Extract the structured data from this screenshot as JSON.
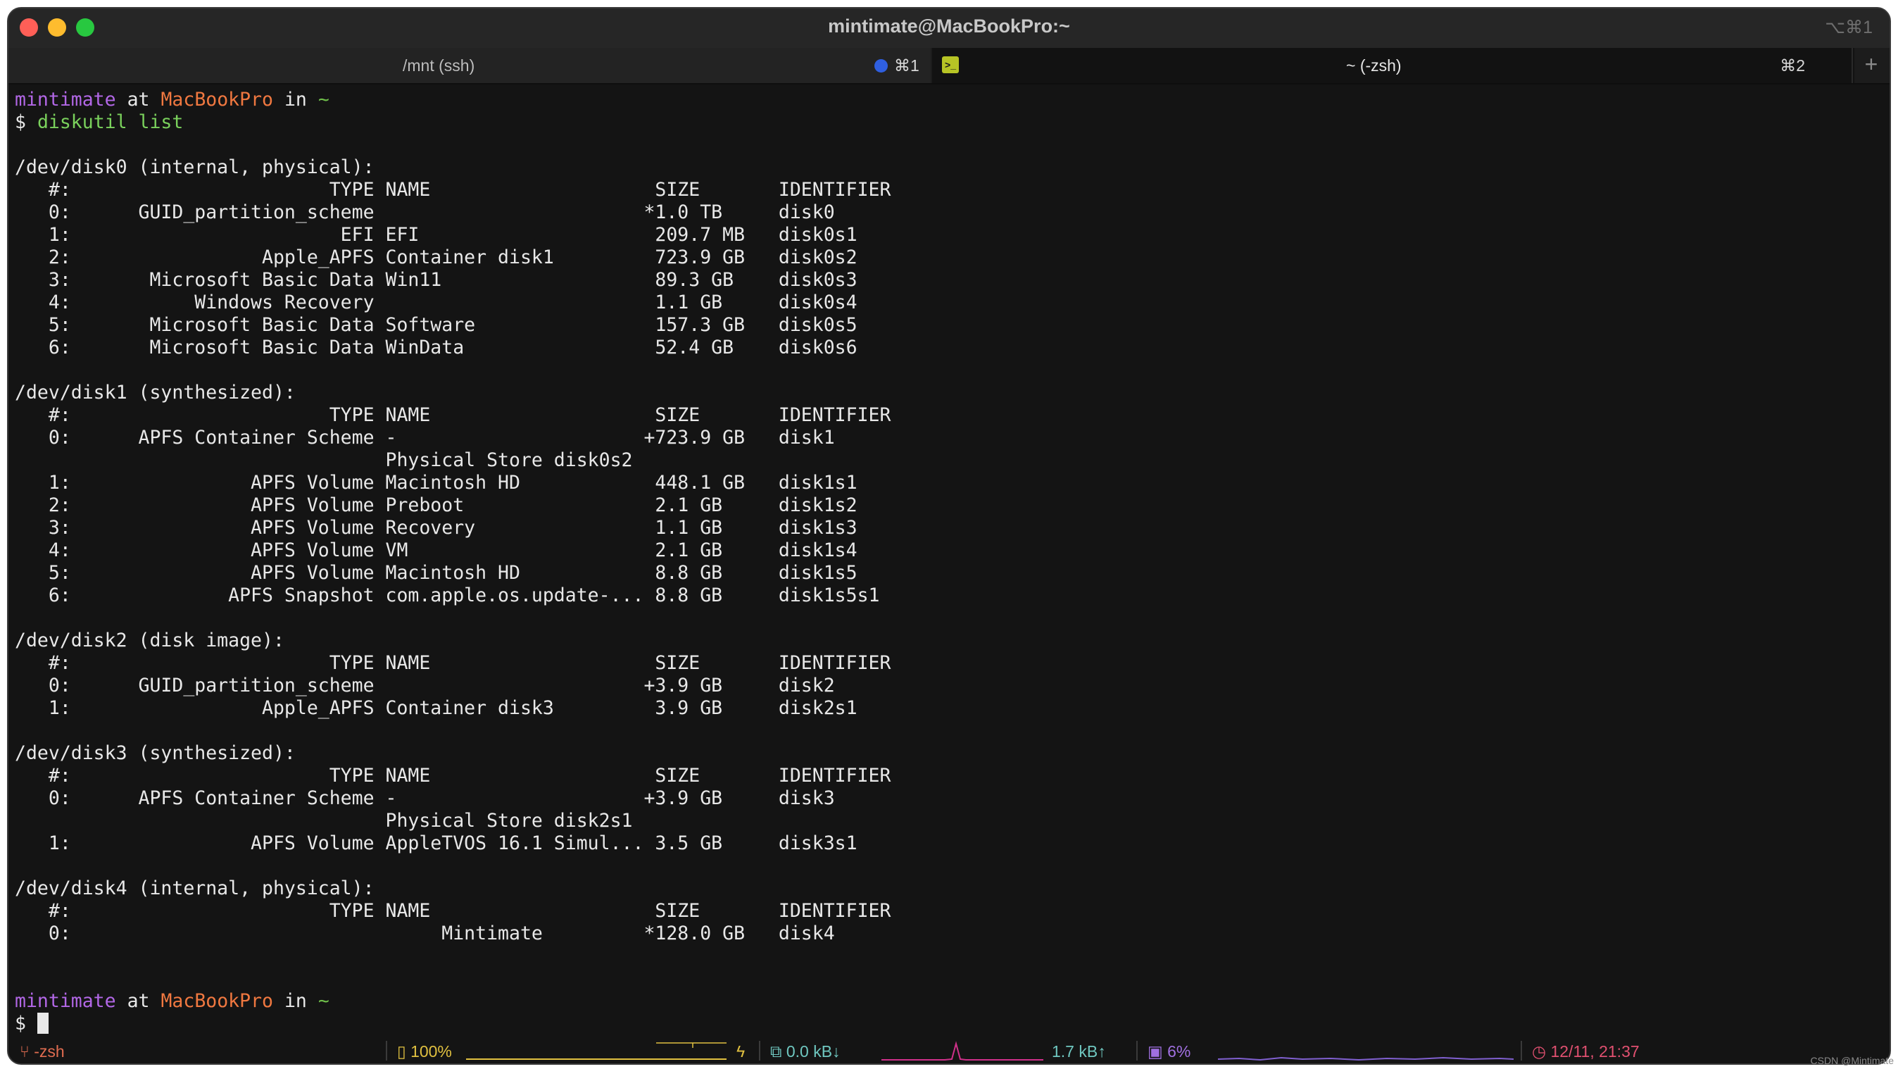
{
  "window": {
    "title": "mintimate@MacBookPro:~",
    "title_shortcut": "⌥⌘1"
  },
  "tabs": [
    {
      "title": "/mnt (ssh)",
      "shortcut": "⌘1",
      "indicator_color": "#2f5fe0"
    },
    {
      "title": "~ (-zsh)",
      "shortcut": "⌘2",
      "icon": "terminal-prompt-icon"
    }
  ],
  "terminal": {
    "prompt_user": "mintimate",
    "prompt_at": "at",
    "prompt_host": "MacBookPro",
    "prompt_in": "in",
    "prompt_dir": "~",
    "command": "diskutil list",
    "output": [
      "/dev/disk0 (internal, physical):",
      "   #:                       TYPE NAME                    SIZE       IDENTIFIER",
      "   0:      GUID_partition_scheme                        *1.0 TB     disk0",
      "   1:                        EFI EFI                     209.7 MB   disk0s1",
      "   2:                 Apple_APFS Container disk1         723.9 GB   disk0s2",
      "   3:       Microsoft Basic Data Win11                   89.3 GB    disk0s3",
      "   4:           Windows Recovery                         1.1 GB     disk0s4",
      "   5:       Microsoft Basic Data Software                157.3 GB   disk0s5",
      "   6:       Microsoft Basic Data WinData                 52.4 GB    disk0s6",
      "",
      "/dev/disk1 (synthesized):",
      "   #:                       TYPE NAME                    SIZE       IDENTIFIER",
      "   0:      APFS Container Scheme -                      +723.9 GB   disk1",
      "                                 Physical Store disk0s2",
      "   1:                APFS Volume Macintosh HD            448.1 GB   disk1s1",
      "   2:                APFS Volume Preboot                 2.1 GB     disk1s2",
      "   3:                APFS Volume Recovery                1.1 GB     disk1s3",
      "   4:                APFS Volume VM                      2.1 GB     disk1s4",
      "   5:                APFS Volume Macintosh HD            8.8 GB     disk1s5",
      "   6:              APFS Snapshot com.apple.os.update-... 8.8 GB     disk1s5s1",
      "",
      "/dev/disk2 (disk image):",
      "   #:                       TYPE NAME                    SIZE       IDENTIFIER",
      "   0:      GUID_partition_scheme                        +3.9 GB     disk2",
      "   1:                 Apple_APFS Container disk3         3.9 GB     disk2s1",
      "",
      "/dev/disk3 (synthesized):",
      "   #:                       TYPE NAME                    SIZE       IDENTIFIER",
      "   0:      APFS Container Scheme -                      +3.9 GB     disk3",
      "                                 Physical Store disk2s1",
      "   1:                APFS Volume AppleTVOS 16.1 Simul... 3.5 GB     disk3s1",
      "",
      "/dev/disk4 (internal, physical):",
      "   #:                       TYPE NAME                    SIZE       IDENTIFIER",
      "   0:                                 Mintimate         *128.0 GB   disk4",
      "",
      ""
    ],
    "final_prompt_symbol": "$"
  },
  "statusbar": {
    "shell": "-zsh",
    "battery": "100%",
    "network_down": "0.0 kB↓",
    "network_up": "1.7 kB↑",
    "cpu": "6%",
    "datetime": "12/11, 21:37",
    "colors": {
      "shell": "#e06c50",
      "battery": "#e0c040",
      "network": "#6fc7c0",
      "cpu": "#a070e0",
      "clock": "#e05070"
    }
  },
  "watermark": "CSDN @Mintimate"
}
